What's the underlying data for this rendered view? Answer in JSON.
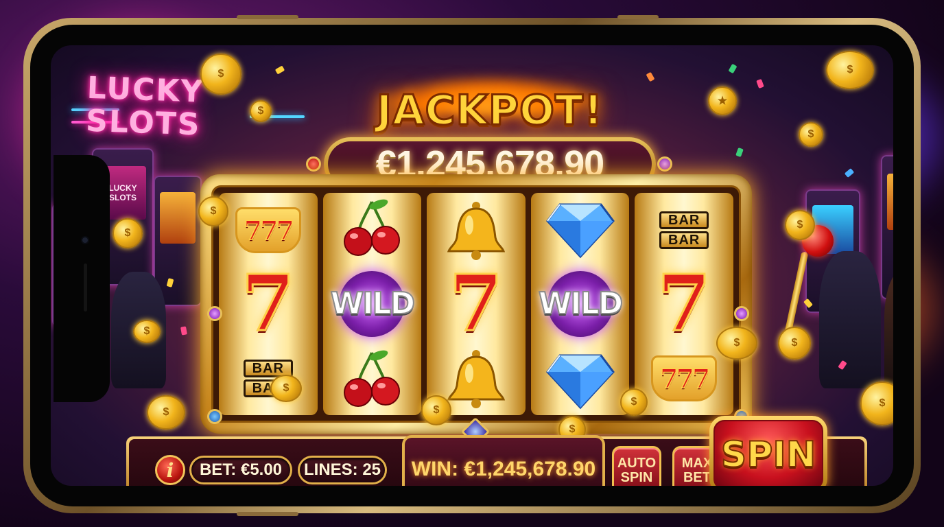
{
  "background": {
    "neon_sign": [
      "LUCKY",
      "SLOTS"
    ],
    "small_sign": [
      "LUCKY",
      "SLOTS"
    ]
  },
  "jackpot": {
    "title": "JACKPOT!",
    "amount": "€1,245,678.90"
  },
  "reels": [
    {
      "symbols": [
        {
          "type": "777",
          "label": "777"
        },
        {
          "type": "seven",
          "label": "7"
        },
        {
          "type": "bar",
          "label": [
            "BAR",
            "BAR"
          ]
        }
      ]
    },
    {
      "symbols": [
        {
          "type": "cherry",
          "label": ""
        },
        {
          "type": "wild",
          "label": "WILD"
        },
        {
          "type": "cherry",
          "label": ""
        }
      ]
    },
    {
      "symbols": [
        {
          "type": "bell",
          "label": ""
        },
        {
          "type": "seven",
          "label": "7"
        },
        {
          "type": "bell",
          "label": ""
        }
      ]
    },
    {
      "symbols": [
        {
          "type": "diamond",
          "label": ""
        },
        {
          "type": "wild",
          "label": "WILD"
        },
        {
          "type": "diamond",
          "label": ""
        }
      ]
    },
    {
      "symbols": [
        {
          "type": "bar",
          "label": [
            "BAR",
            "BAR"
          ]
        },
        {
          "type": "seven",
          "label": "7"
        },
        {
          "type": "777",
          "label": "777"
        }
      ]
    }
  ],
  "controls": {
    "info_label": "i",
    "bet": "BET: €5.00",
    "lines": "LINES: 25",
    "win": "WIN: €1,245,678.90",
    "auto_spin": "AUTO\nSPIN",
    "max_bet": "MAX\nBET",
    "spin": "SPIN"
  },
  "colors": {
    "gold": "#f2b51c",
    "jackpot_text": "#ffd43b",
    "spin_red": "#c8101e",
    "panel_maroon": "#3a0d18",
    "neon_pink": "#ff1e9a",
    "wild_purple": "#7a1ea8"
  },
  "icons": [
    "info-icon",
    "coin-icon",
    "cherry-icon",
    "bell-icon",
    "diamond-icon",
    "lever-icon",
    "star-icon"
  ]
}
